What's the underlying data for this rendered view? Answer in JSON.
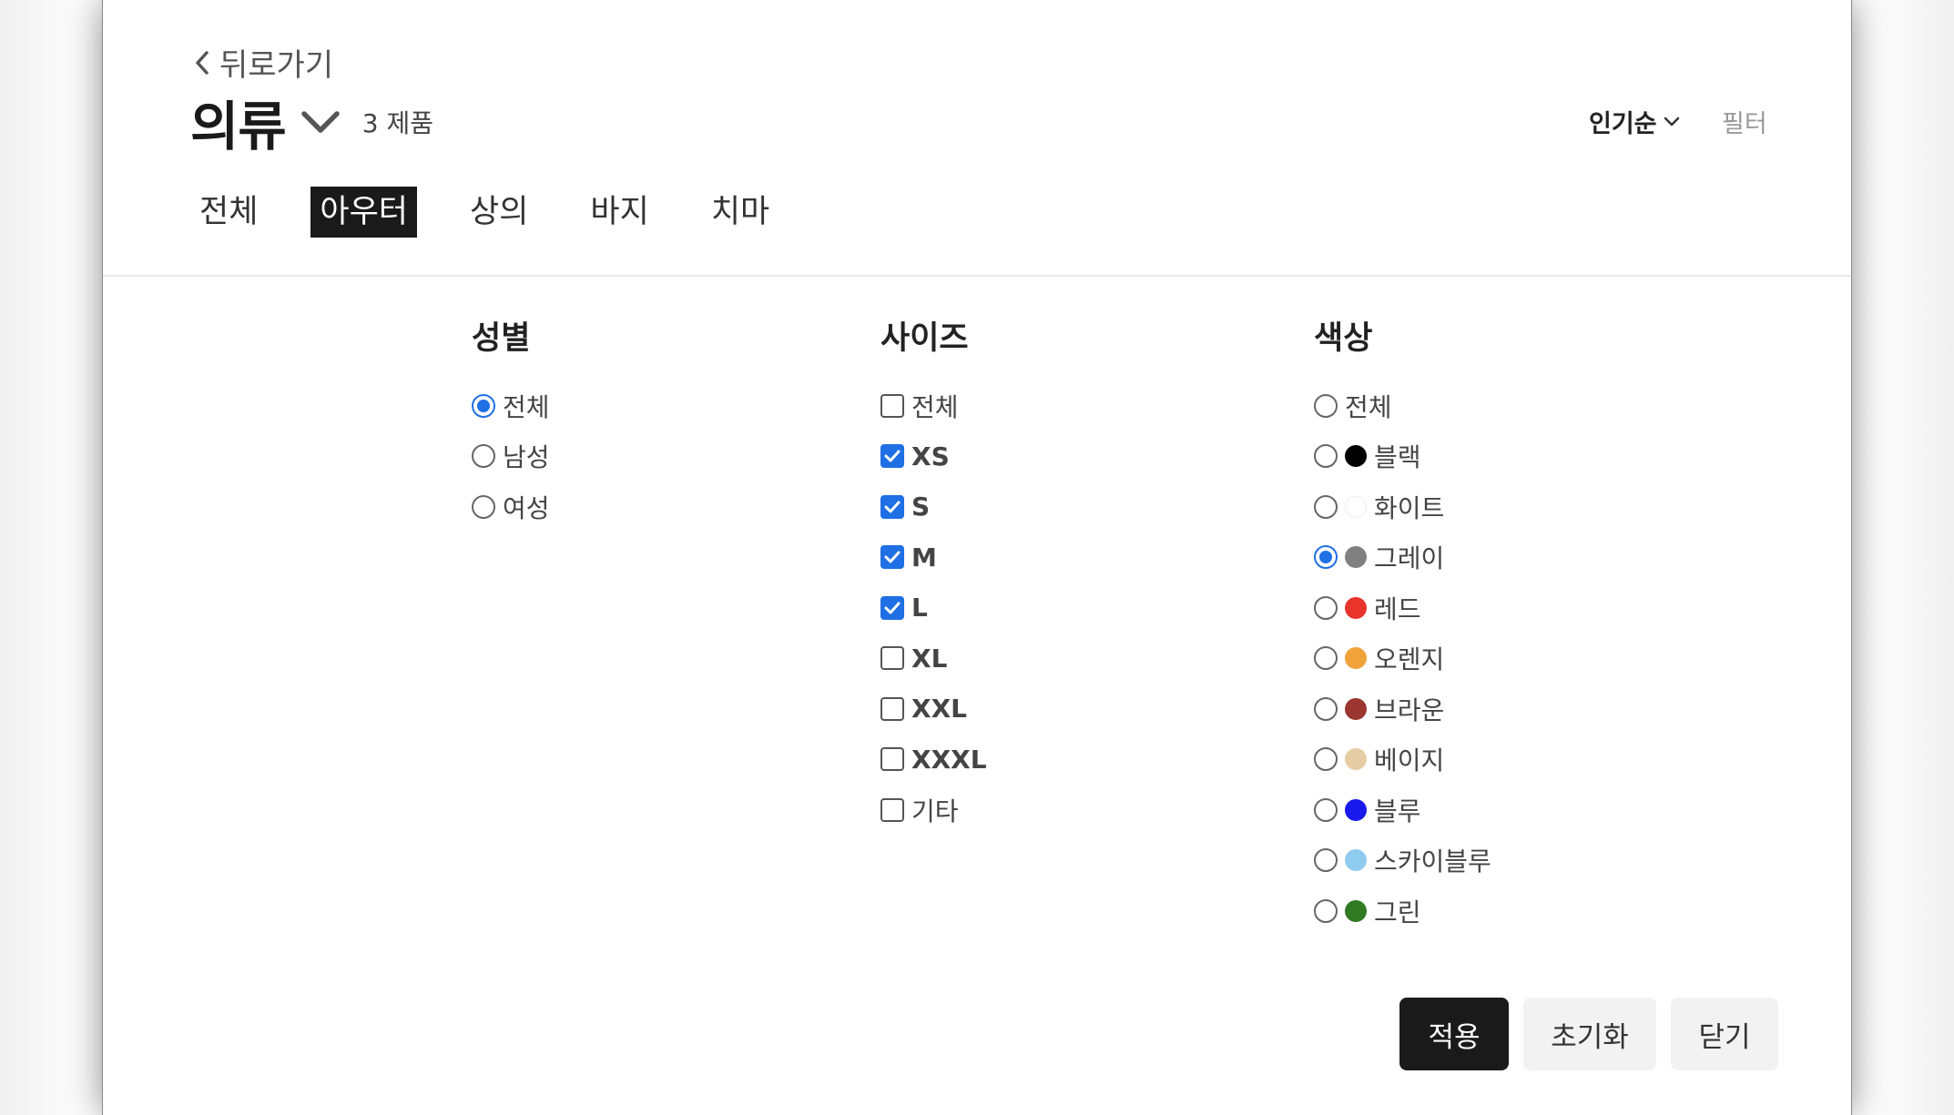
{
  "header": {
    "back_label": "뒤로가기",
    "title": "의류",
    "product_count": "3 제품",
    "sort_label": "인기순",
    "filter_label": "필터"
  },
  "tabs": [
    {
      "label": "전체",
      "active": false
    },
    {
      "label": "아우터",
      "active": true
    },
    {
      "label": "상의",
      "active": false
    },
    {
      "label": "바지",
      "active": false
    },
    {
      "label": "치마",
      "active": false
    }
  ],
  "filters": {
    "gender": {
      "title": "성별",
      "options": [
        {
          "label": "전체",
          "checked": true
        },
        {
          "label": "남성",
          "checked": false
        },
        {
          "label": "여성",
          "checked": false
        }
      ]
    },
    "size": {
      "title": "사이즈",
      "options": [
        {
          "label": "전체",
          "checked": false
        },
        {
          "label": "XS",
          "checked": true
        },
        {
          "label": "S",
          "checked": true
        },
        {
          "label": "M",
          "checked": true
        },
        {
          "label": "L",
          "checked": true
        },
        {
          "label": "XL",
          "checked": false
        },
        {
          "label": "XXL",
          "checked": false
        },
        {
          "label": "XXXL",
          "checked": false
        },
        {
          "label": "기타",
          "checked": false
        }
      ]
    },
    "color": {
      "title": "색상",
      "options": [
        {
          "label": "전체",
          "checked": false,
          "swatch": null
        },
        {
          "label": "블랙",
          "checked": false,
          "swatch": "#000000"
        },
        {
          "label": "화이트",
          "checked": false,
          "swatch": "#ffffff"
        },
        {
          "label": "그레이",
          "checked": true,
          "swatch": "#808080"
        },
        {
          "label": "레드",
          "checked": false,
          "swatch": "#e8342a"
        },
        {
          "label": "오렌지",
          "checked": false,
          "swatch": "#f0a33a"
        },
        {
          "label": "브라운",
          "checked": false,
          "swatch": "#9a3530"
        },
        {
          "label": "베이지",
          "checked": false,
          "swatch": "#e6cca4"
        },
        {
          "label": "블루",
          "checked": false,
          "swatch": "#1a1aee"
        },
        {
          "label": "스카이블루",
          "checked": false,
          "swatch": "#8ecbee"
        },
        {
          "label": "그린",
          "checked": false,
          "swatch": "#2f7a22"
        }
      ]
    }
  },
  "buttons": {
    "apply": "적용",
    "reset": "초기화",
    "close": "닫기"
  },
  "colors": {
    "accent": "#1f6fe5",
    "primary_button": "#1a1a1a"
  }
}
